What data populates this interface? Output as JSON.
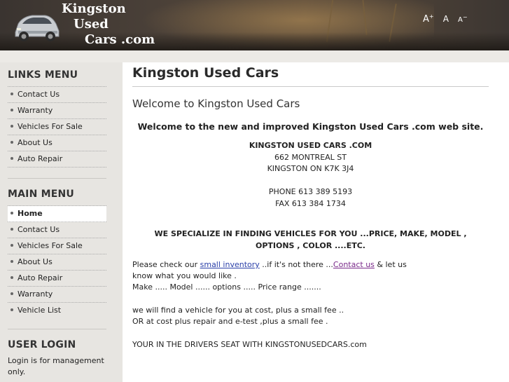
{
  "header": {
    "logo_line1": "Kingston",
    "logo_line2": "Used",
    "logo_line3": "Cars .com",
    "font_increase": "A",
    "font_increase_sup": "+",
    "font_reset": "A",
    "font_decrease": "A",
    "font_decrease_sup": "−"
  },
  "links_menu": {
    "title": "LINKS MENU",
    "items": [
      "Contact Us",
      "Warranty",
      "Vehicles For Sale",
      "About Us",
      "Auto Repair"
    ]
  },
  "main_menu": {
    "title": "MAIN MENU",
    "items": [
      "Home",
      "Contact Us",
      "Vehicles For Sale",
      "About Us",
      "Auto Repair",
      "Warranty",
      "Vehicle List"
    ],
    "active_index": 0
  },
  "user_login": {
    "title": "USER LOGIN",
    "text": "Login is for management only."
  },
  "content": {
    "page_title": "Kingston Used Cars",
    "subtitle": "Welcome to Kingston Used Cars",
    "welcome": "Welcome to the new and improved Kingston Used Cars .com web site.",
    "company_name": "KINGSTON USED CARS .COM",
    "address1": "662 MONTREAL ST",
    "address2": "KINGSTON ON K7K 3J4",
    "phone": "PHONE 613 389 5193",
    "fax": "FAX 613 384 1734",
    "specialize1": "WE SPECIALIZE IN FINDING VEHICLES FOR YOU ...PRICE, MAKE, MODEL ,",
    "specialize2": "OPTIONS , COLOR ....ETC.",
    "check_prefix": "Please check our ",
    "small_inventory_link": " small inventory",
    "check_middle": " ..if it's not there ...",
    "contact_link": "Contact us",
    "check_suffix": " & let us",
    "know_line": "know what you would like .",
    "make_line": "Make ..... Model ...... options ..... Price range .......",
    "find_line": "we will find a vehicle for you at cost, plus a small fee ..",
    "repair_line": "OR at cost plus repair and e-test ,plus a small fee .",
    "seat_line": "YOUR IN THE DRIVERS SEAT WITH KINGSTONUSEDCARS.com"
  },
  "colors": {
    "link": "#2a3fa8",
    "visited_link": "#7a2a8a",
    "sidebar_bg": "#e7e5e1"
  }
}
